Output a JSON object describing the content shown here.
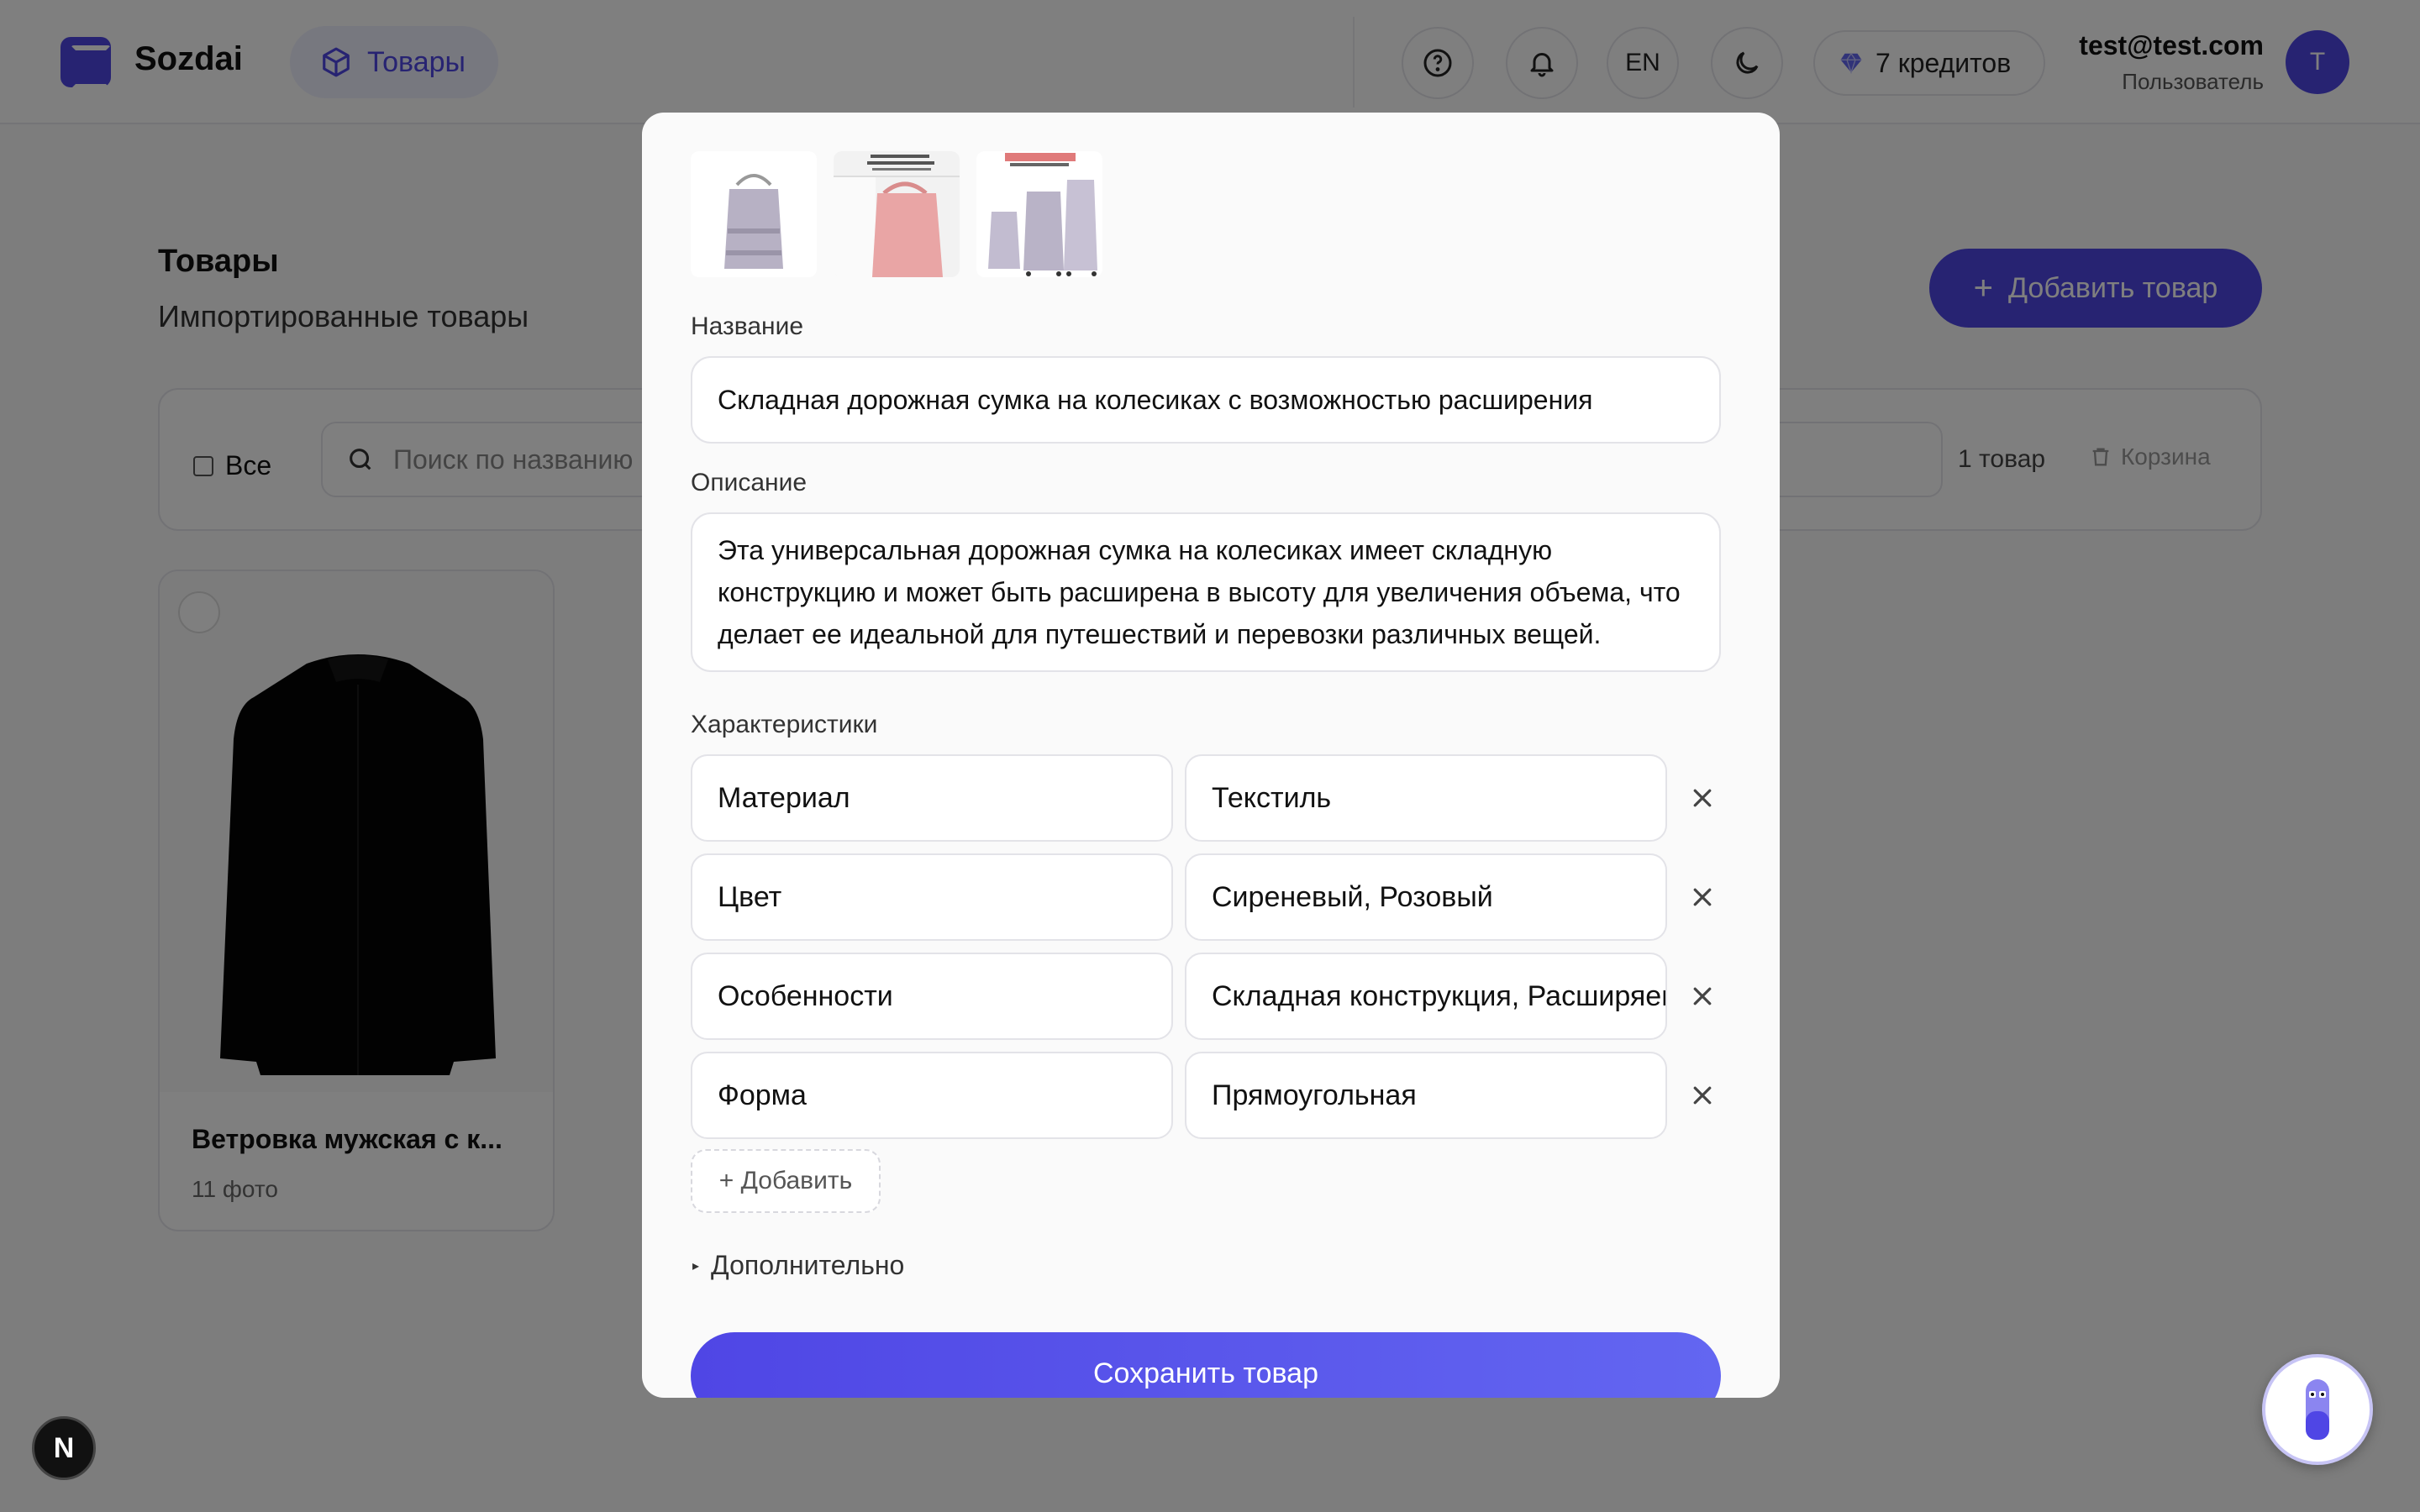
{
  "header": {
    "brand": "Sozdai",
    "nav_active": "Товары",
    "lang": "EN",
    "credits": "7 кредитов",
    "user_email": "test@test.com",
    "user_role": "Пользователь",
    "avatar_letter": "T"
  },
  "page": {
    "title": "Товары",
    "subtitle": "Импортированные товары",
    "add_button": "Добавить товар",
    "select_all": "Все",
    "search_placeholder": "Поиск по названию",
    "count": "1 товар",
    "trash": "Корзина"
  },
  "product_card": {
    "title": "Ветровка мужская с к...",
    "photos": "11 фото"
  },
  "modal": {
    "name_label": "Название",
    "name_value": "Складная дорожная сумка на колесиках с возможностью расширения",
    "desc_label": "Описание",
    "desc_value": "Эта универсальная дорожная сумка на колесиках имеет складную конструкцию и может быть расширена в высоту для увеличения объема, что делает ее идеальной для путешествий и перевозки различных вещей.",
    "attrs_label": "Характеристики",
    "attrs": [
      {
        "key": "Материал",
        "value": "Текстиль"
      },
      {
        "key": "Цвет",
        "value": "Сиреневый, Розовый"
      },
      {
        "key": "Особенности",
        "value": "Складная конструкция, Расширяемая"
      },
      {
        "key": "Форма",
        "value": "Прямоугольная"
      }
    ],
    "add_attr": "+ Добавить",
    "more": "Дополнительно",
    "save": "Сохранить товар"
  },
  "fab": {
    "n_label": "N"
  }
}
